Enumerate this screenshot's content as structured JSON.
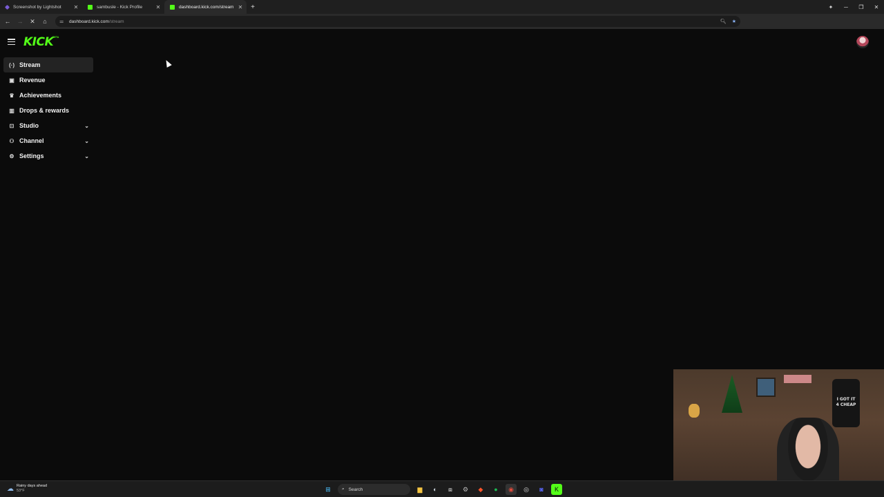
{
  "browser": {
    "tabs": [
      {
        "title": "Screenshot by Lightshot",
        "favicon_color": "#7a5cd6",
        "active": false
      },
      {
        "title": "sambusle - Kick Profile",
        "favicon_color": "#53fc18",
        "active": false
      },
      {
        "title": "dashboard.kick.com/stream",
        "favicon_color": "#53fc18",
        "active": true
      }
    ],
    "new_tab_symbol": "+",
    "url_host": "dashboard.kick.com",
    "url_path": "/stream"
  },
  "app": {
    "logo": "KICK",
    "logo_badge": "BETA",
    "accent": "#53fc18",
    "nav": [
      {
        "label": "Stream",
        "icon": "broadcast-icon",
        "glyph": "((·))",
        "active": true,
        "expandable": false
      },
      {
        "label": "Revenue",
        "icon": "revenue-icon",
        "glyph": "▣",
        "active": false,
        "expandable": false
      },
      {
        "label": "Achievements",
        "icon": "trophy-icon",
        "glyph": "🏆",
        "active": false,
        "expandable": false
      },
      {
        "label": "Drops & rewards",
        "icon": "drops-icon",
        "glyph": "▥",
        "active": false,
        "expandable": false
      },
      {
        "label": "Studio",
        "icon": "studio-icon",
        "glyph": "⊡",
        "active": false,
        "expandable": true
      },
      {
        "label": "Channel",
        "icon": "channel-icon",
        "glyph": "⚇",
        "active": false,
        "expandable": true
      },
      {
        "label": "Settings",
        "icon": "gear-icon",
        "glyph": "⚙",
        "active": false,
        "expandable": true
      }
    ]
  },
  "webcam": {
    "shirt_text": "I GOT IT 4 CHEAP"
  },
  "taskbar": {
    "weather_title": "Rainy days ahead",
    "weather_temp": "53°F",
    "search_label": "Search"
  }
}
